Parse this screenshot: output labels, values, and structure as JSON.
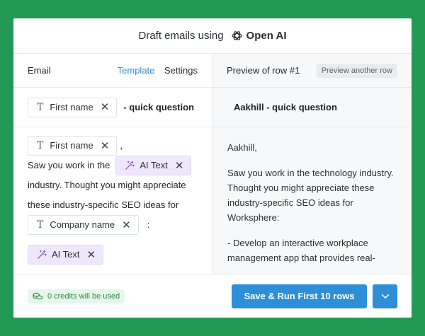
{
  "header": {
    "prefix": "Draft emails using",
    "brand": "Open AI"
  },
  "left": {
    "title": "Email",
    "tabs": [
      {
        "label": "Template",
        "active": true
      },
      {
        "label": "Settings",
        "active": false
      }
    ],
    "subject": {
      "chip": "First name",
      "suffix": "- quick question"
    },
    "body": {
      "greeting_chip": "First name",
      "greeting_suffix": ",",
      "line1_prefix": "Saw you work in the",
      "ai_chip": "AI Text",
      "line2": "industry. Thought you might appreciate",
      "line3": "these industry-specific SEO ideas for",
      "company_chip": "Company name",
      "company_suffix": ":",
      "ai_chip2": "AI Text"
    }
  },
  "right": {
    "title": "Preview of row #1",
    "preview_button": "Preview another row",
    "subject": "Aakhill - quick question",
    "paragraphs": [
      "Aakhill,",
      "Saw you work in the technology industry.  Thought you might appreciate these industry-specific SEO ideas for Worksphere:",
      "- Develop an interactive workplace management app that provides real-"
    ]
  },
  "footer": {
    "credits": "0 credits will be used",
    "run_label": "Save & Run First 10 rows"
  },
  "colors": {
    "accent": "#2e8fd8",
    "background": "#229a55",
    "ai_chip": "#efe7fb",
    "credits_bg": "#e7f6ea"
  },
  "icons": [
    "openai-logo-icon",
    "text-type-icon",
    "close-icon",
    "magic-wand-icon",
    "coins-icon",
    "chevron-down-icon"
  ]
}
